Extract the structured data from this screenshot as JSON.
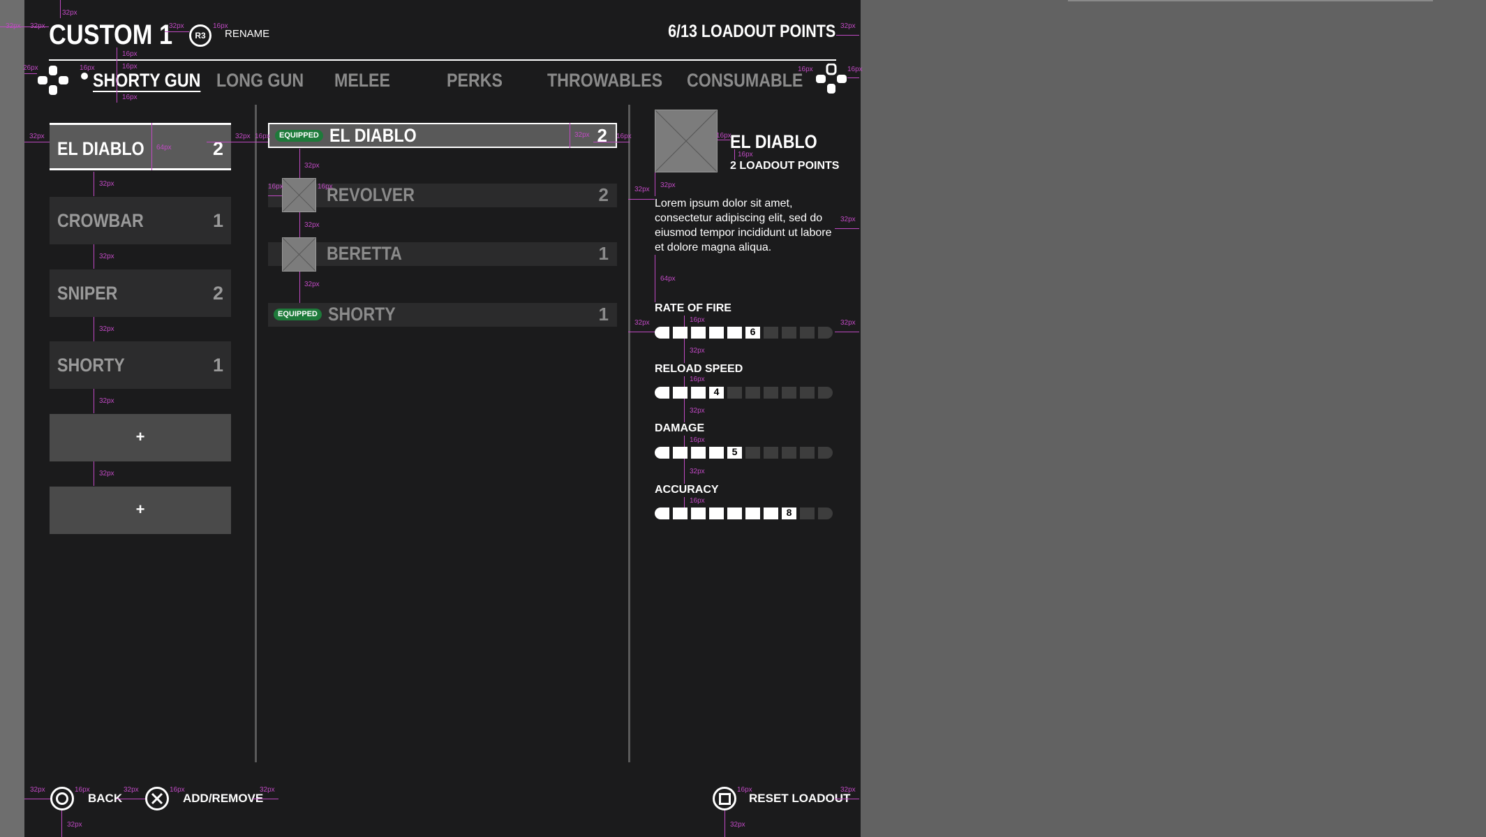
{
  "header": {
    "title": "CUSTOM 1",
    "rename_glyph": "R3",
    "rename_label": "RENAME",
    "points_label": "6/13 LOADOUT POINTS"
  },
  "tabs": [
    {
      "label": "SHORTY GUN",
      "active": true
    },
    {
      "label": "LONG GUN",
      "active": false
    },
    {
      "label": "MELEE",
      "active": false
    },
    {
      "label": "PERKS",
      "active": false
    },
    {
      "label": "THROWABLES",
      "active": false
    },
    {
      "label": "CONSUMABLE",
      "active": false
    }
  ],
  "slots": [
    {
      "name": "EL DIABLO",
      "points": "2",
      "active": true
    },
    {
      "name": "CROWBAR",
      "points": "1"
    },
    {
      "name": "SNIPER",
      "points": "2"
    },
    {
      "name": "SHORTY",
      "points": "1"
    },
    {
      "name": "",
      "plus": "+"
    },
    {
      "name": "",
      "plus": "+"
    }
  ],
  "items": [
    {
      "name": "EL DIABLO",
      "points": "2",
      "badge": "EQUIPPED",
      "active": true
    },
    {
      "name": "REVOLVER",
      "points": "2",
      "thumb": true
    },
    {
      "name": "BERETTA",
      "points": "1",
      "thumb": true
    },
    {
      "name": "SHORTY",
      "points": "1",
      "badge": "EQUIPPED"
    }
  ],
  "detail": {
    "name": "EL DIABLO",
    "points": "2 LOADOUT POINTS",
    "description": "Lorem ipsum dolor sit amet, consectetur adipiscing elit, sed do eiusmod tempor incididunt ut labore et dolore magna aliqua.",
    "stats": [
      {
        "label": "RATE OF FIRE",
        "value": 6,
        "max": 10
      },
      {
        "label": "RELOAD SPEED",
        "value": 4,
        "max": 10
      },
      {
        "label": "DAMAGE",
        "value": 5,
        "max": 10
      },
      {
        "label": "ACCURACY",
        "value": 8,
        "max": 10
      }
    ]
  },
  "footer": {
    "back": "BACK",
    "add_remove": "ADD/REMOVE",
    "reset": "RESET LOADOUT"
  },
  "spec": {
    "s32": "32px",
    "s16": "16px",
    "s64": "64px",
    "s26": "26px"
  },
  "colors": {
    "panel": "#1b1b1c",
    "accent_magenta": "#c14ac4",
    "equipped_green": "#1e7a3a"
  }
}
